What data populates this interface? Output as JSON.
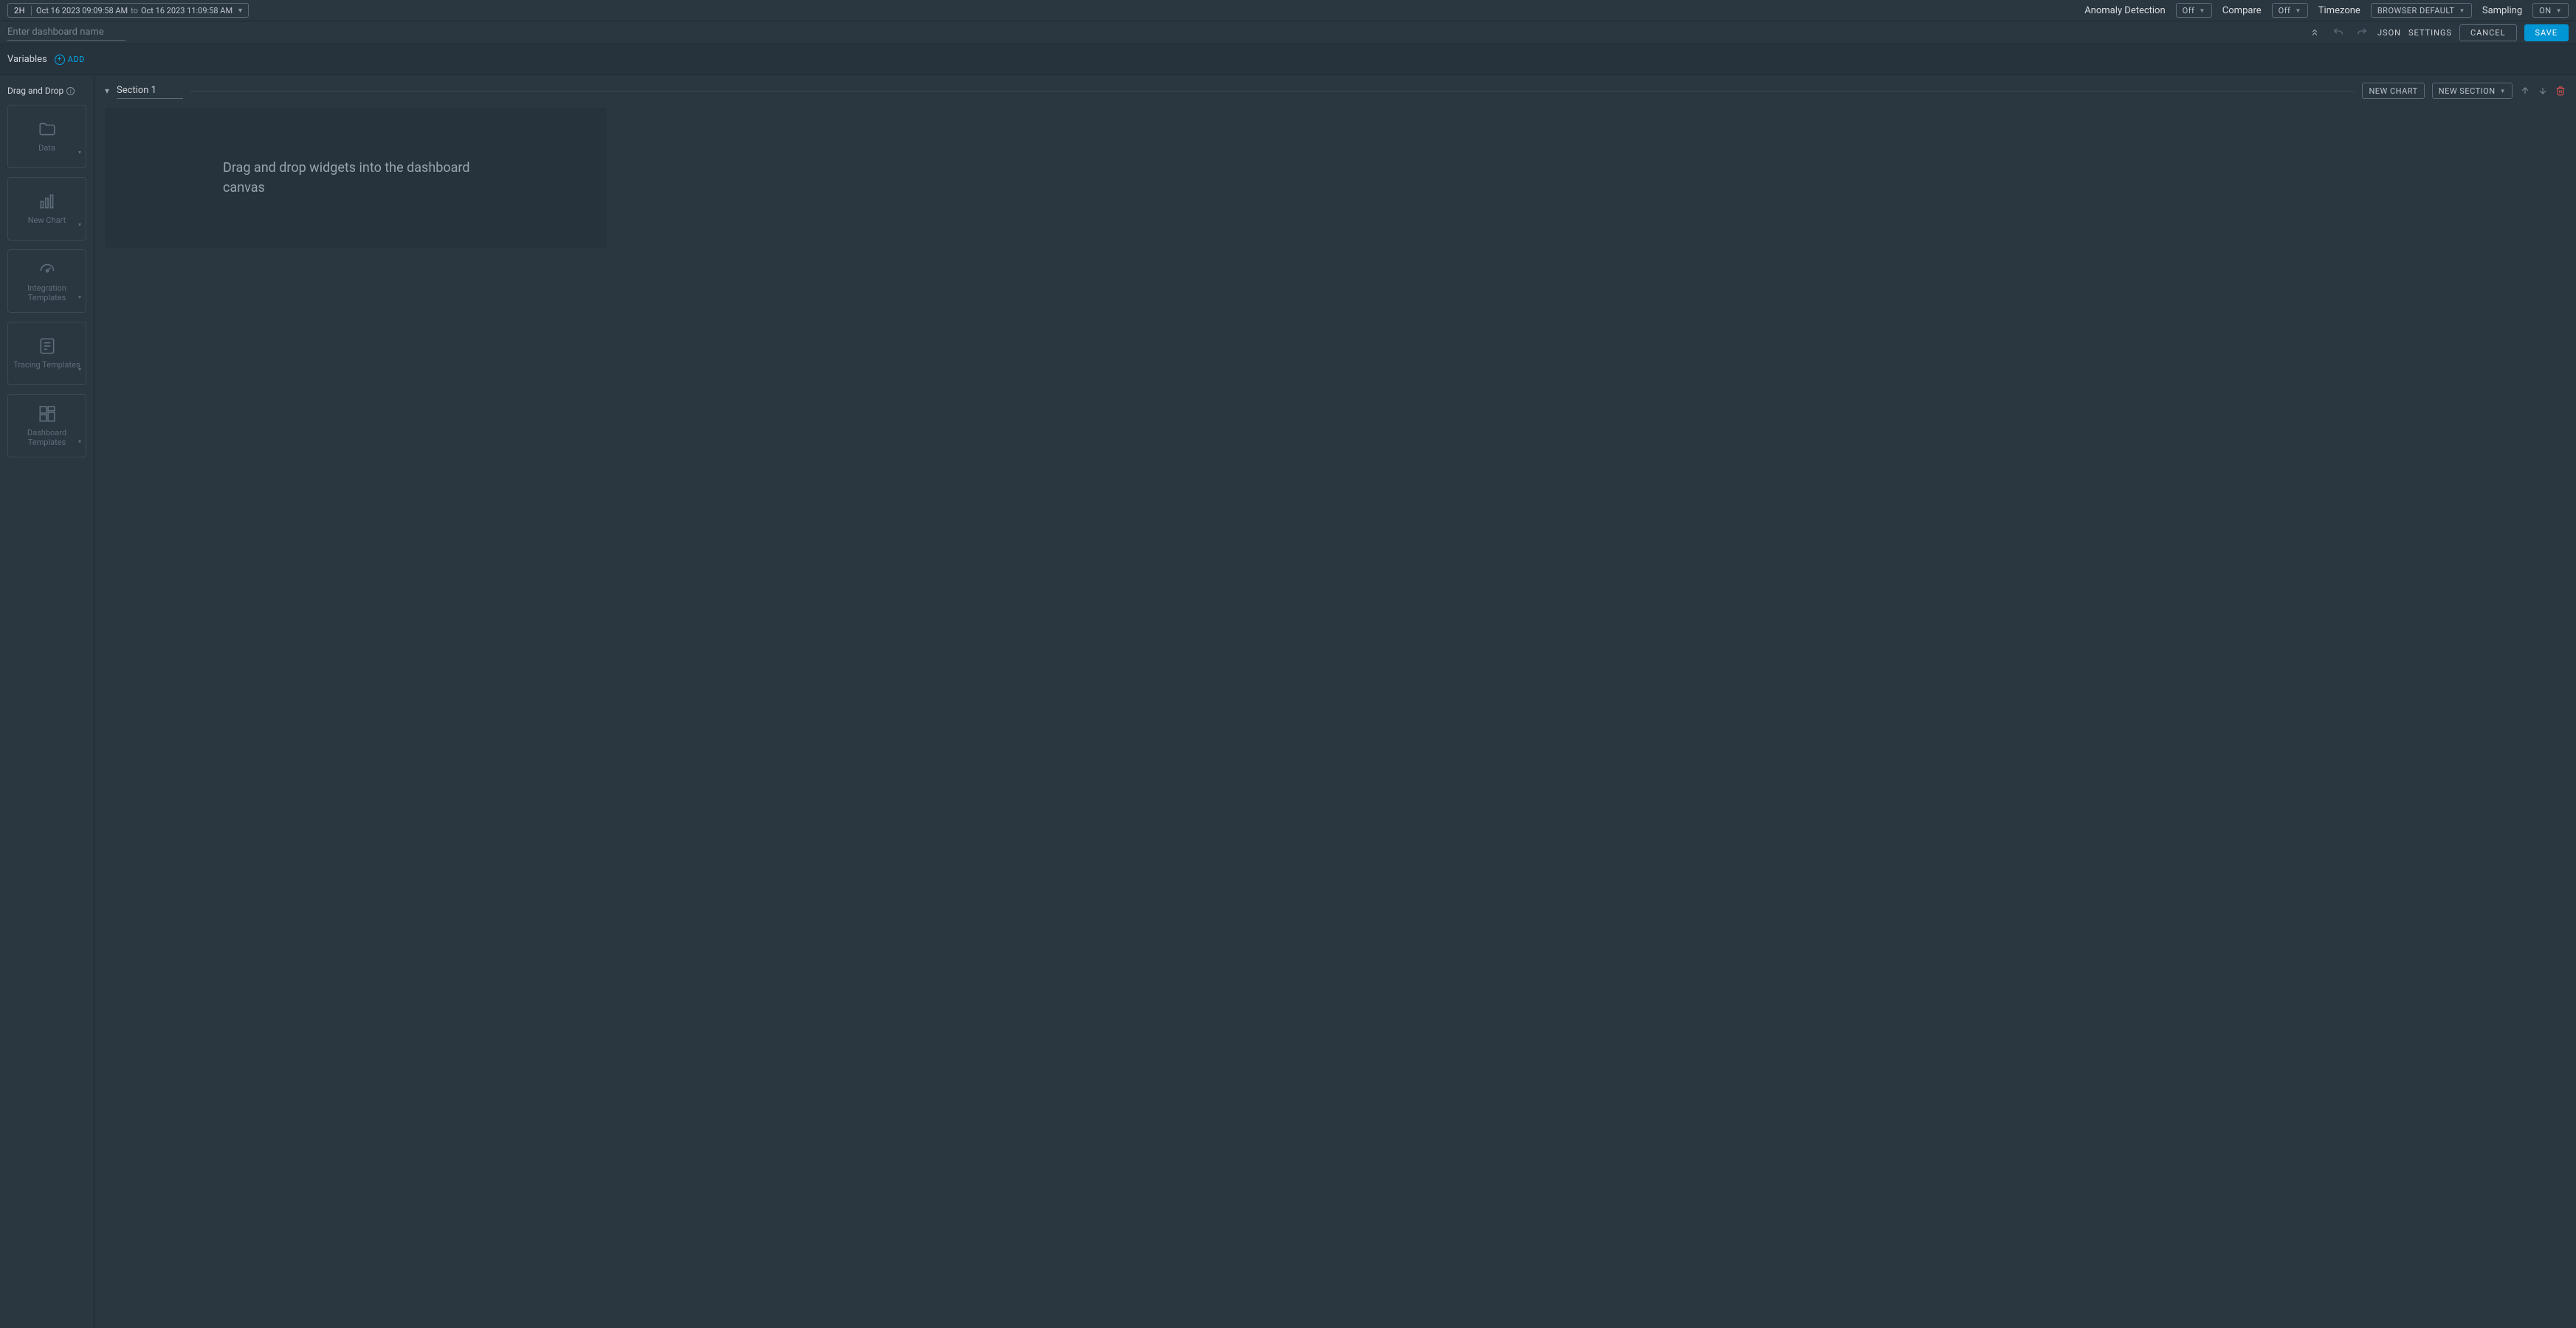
{
  "top_bar": {
    "duration": "2H",
    "range_start": "Oct 16 2023 09:09:58 AM",
    "range_to": "to",
    "range_end": "Oct 16 2023 11:09:58 AM",
    "anomaly_label": "Anomaly Detection",
    "anomaly_value": "Off",
    "compare_label": "Compare",
    "compare_value": "Off",
    "timezone_label": "Timezone",
    "timezone_value": "BROWSER DEFAULT",
    "sampling_label": "Sampling",
    "sampling_value": "ON"
  },
  "name_bar": {
    "dashboard_name_placeholder": "Enter dashboard name",
    "json_label": "JSON",
    "settings_label": "SETTINGS",
    "cancel_label": "CANCEL",
    "save_label": "SAVE"
  },
  "variables_bar": {
    "label": "Variables",
    "add_label": "ADD"
  },
  "sidebar": {
    "title": "Drag and Drop",
    "tiles": [
      {
        "label": "Data"
      },
      {
        "label": "New Chart"
      },
      {
        "label": "Integration Templates"
      },
      {
        "label": "Tracing Templates"
      },
      {
        "label": "Dashboard Templates"
      }
    ]
  },
  "canvas": {
    "section_name": "Section 1",
    "new_chart_label": "NEW CHART",
    "new_section_label": "NEW SECTION",
    "placeholder_text": "Drag and drop widgets into the dashboard canvas"
  }
}
